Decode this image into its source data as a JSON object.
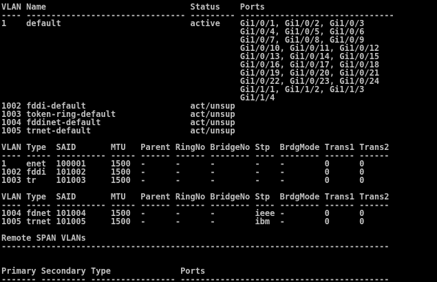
{
  "terminal": {
    "lines": [
      "VLAN Name                             Status    Ports",
      "---- -------------------------------- --------- -------------------------------",
      "1    default                          active    Gi1/0/1, Gi1/0/2, Gi1/0/3",
      "                                                Gi1/0/4, Gi1/0/5, Gi1/0/6",
      "                                                Gi1/0/7, Gi1/0/8, Gi1/0/9",
      "                                                Gi1/0/10, Gi1/0/11, Gi1/0/12",
      "                                                Gi1/0/13, Gi1/0/14, Gi1/0/15",
      "                                                Gi1/0/16, Gi1/0/17, Gi1/0/18",
      "                                                Gi1/0/19, Gi1/0/20, Gi1/0/21",
      "                                                Gi1/0/22, Gi1/0/23, Gi1/0/24",
      "                                                Gi1/1/1, Gi1/1/2, Gi1/1/3",
      "                                                Gi1/1/4",
      "1002 fddi-default                     act/unsup",
      "1003 token-ring-default               act/unsup",
      "1004 fddinet-default                  act/unsup",
      "1005 trnet-default                    act/unsup",
      "",
      "VLAN Type  SAID       MTU   Parent RingNo BridgeNo Stp  BrdgMode Trans1 Trans2",
      "---- ----- ---------- ----- ------ ------ -------- ---- -------- ------ ------",
      "1    enet  100001     1500  -      -      -        -    -        0      0",
      "1002 fddi  101002     1500  -      -      -        -    -        0      0",
      "1003 tr    101003     1500  -      -      -        -    -        0      0",
      "",
      "VLAN Type  SAID       MTU   Parent RingNo BridgeNo Stp  BrdgMode Trans1 Trans2",
      "---- ----- ---------- ----- ------ ------ -------- ---- -------- ------ ------",
      "1004 fdnet 101004     1500  -      -      -        ieee -        0      0",
      "1005 trnet 101005     1500  -      -      -        ibm  -        0      0",
      "",
      "Remote SPAN VLANs",
      "------------------------------------------------------------------------------",
      "",
      "",
      "Primary Secondary Type              Ports",
      "------- --------- ----------------- ------------------------------------------"
    ]
  }
}
